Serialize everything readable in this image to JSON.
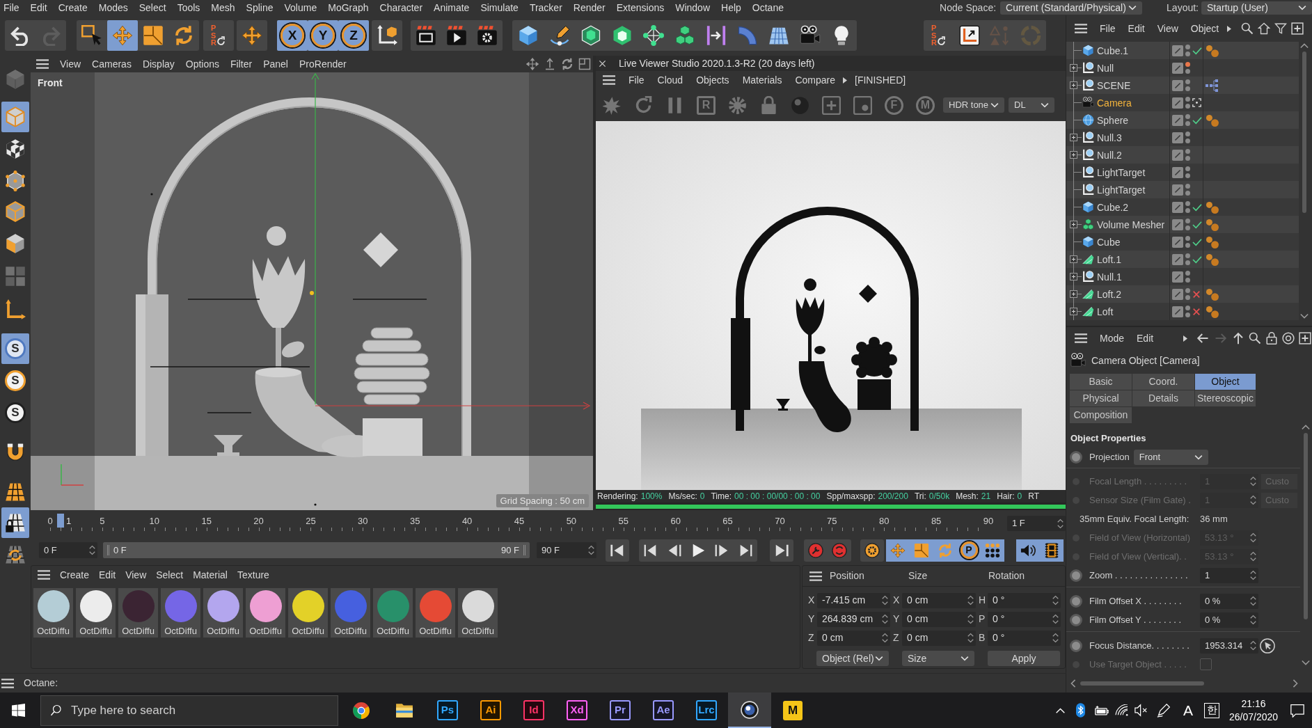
{
  "menu_bar": {
    "items": [
      "File",
      "Edit",
      "Create",
      "Modes",
      "Select",
      "Tools",
      "Mesh",
      "Spline",
      "Volume",
      "MoGraph",
      "Character",
      "Animate",
      "Simulate",
      "Tracker",
      "Render",
      "Extensions",
      "Window",
      "Help",
      "Octane"
    ],
    "node_space": {
      "label": "Node Space:",
      "value": "Current (Standard/Physical)"
    },
    "layout": {
      "label": "Layout:",
      "value": "Startup (User)"
    }
  },
  "main_toolbar": [
    {
      "buttons": [
        {
          "active": false,
          "disabled": false
        },
        {
          "active": false,
          "disabled": true
        }
      ]
    },
    {
      "buttons": [
        {
          "active": false,
          "disabled": false
        },
        {
          "active": true,
          "disabled": false
        },
        {
          "active": false,
          "disabled": false
        },
        {
          "active": false,
          "disabled": false
        }
      ]
    },
    {
      "buttons": [
        {
          "label": "PSR",
          "active": false,
          "disabled": false
        }
      ]
    },
    {
      "buttons": [
        {
          "active": false,
          "disabled": false
        }
      ]
    },
    {
      "buttons": [
        {
          "label": "X",
          "active": true,
          "disabled": false
        },
        {
          "label": "Y",
          "active": true,
          "disabled": false
        },
        {
          "label": "Z",
          "active": true,
          "disabled": false
        }
      ]
    },
    {
      "buttons": [
        {
          "active": false,
          "disabled": false
        }
      ]
    },
    {
      "buttons": [
        {
          "active": false,
          "disabled": false
        },
        {
          "active": false,
          "disabled": false
        },
        {
          "active": false,
          "disabled": false
        }
      ]
    },
    {
      "buttons": [
        {
          "active": false,
          "disabled": false
        },
        {
          "active": false,
          "disabled": false
        },
        {
          "active": false,
          "disabled": false
        },
        {
          "active": false,
          "disabled": false
        },
        {
          "active": false,
          "disabled": false
        },
        {
          "active": false,
          "disabled": false
        },
        {
          "active": false,
          "disabled": false
        },
        {
          "active": false,
          "disabled": false
        },
        {
          "active": false,
          "disabled": false
        },
        {
          "active": false,
          "disabled": false
        },
        {
          "active": false,
          "disabled": false
        }
      ]
    },
    {
      "buttons": [
        {
          "label": "PSR",
          "active": false,
          "disabled": false
        },
        {
          "active": false,
          "disabled": false
        },
        {
          "active": false,
          "disabled": true
        },
        {
          "active": false,
          "disabled": true
        }
      ]
    }
  ],
  "left_toolbar": [
    {
      "active": false,
      "disabled": true
    },
    {
      "active": true,
      "disabled": false
    },
    {
      "active": false,
      "disabled": false
    },
    {
      "active": false,
      "disabled": false
    },
    {
      "active": false,
      "disabled": false
    },
    {
      "active": false,
      "disabled": false
    },
    {
      "active": false,
      "disabled": true
    },
    {
      "active": false,
      "disabled": false
    },
    {
      "label": "S",
      "active": true,
      "disabled": false
    },
    {
      "label": "S",
      "active": false,
      "disabled": false
    },
    {
      "label": "S",
      "active": false,
      "disabled": false
    },
    {
      "active": false,
      "disabled": false
    },
    {
      "active": false,
      "disabled": false
    },
    {
      "active": true,
      "disabled": false
    },
    {
      "active": false,
      "disabled": false
    }
  ],
  "viewport": {
    "menu": [
      "View",
      "Cameras",
      "Display",
      "Options",
      "Filter",
      "Panel",
      "ProRender"
    ],
    "view_label": "Front",
    "grid_spacing": "Grid Spacing : 50 cm"
  },
  "live_viewer": {
    "title": "Live Viewer Studio 2020.1.3-R2 (20 days left)",
    "menu": [
      "File",
      "Cloud",
      "Objects",
      "Materials",
      "Compare"
    ],
    "state": "[FINISHED]",
    "toolbar": [
      {
        "disabled": true
      },
      {
        "disabled": true
      },
      {
        "disabled": true
      },
      {
        "label": "R",
        "disabled": true
      },
      {
        "disabled": true
      },
      {
        "disabled": true
      },
      {
        "disabled": true
      },
      {
        "disabled": true
      },
      {
        "disabled": true
      },
      {
        "label": "F",
        "disabled": true
      },
      {
        "label": "M",
        "disabled": true
      }
    ],
    "tone_mapping": "HDR tone",
    "channel": "DL",
    "stats": [
      {
        "label": "Rendering:",
        "value": "100%"
      },
      {
        "label": "Ms/sec:",
        "value": "0"
      },
      {
        "label": "Time:",
        "value": "00 : 00 : 00/00 : 00 : 00"
      },
      {
        "label": "Spp/maxspp:",
        "value": "200/200"
      },
      {
        "label": "Tri:",
        "value": "0/50k"
      },
      {
        "label": "Mesh:",
        "value": "21"
      },
      {
        "label": "Hair:",
        "value": "0"
      },
      {
        "label": "RT"
      }
    ],
    "progress": {
      "level": 1
    }
  },
  "timeline": {
    "ruler_labels": [
      "0",
      "5",
      "10",
      "15",
      "20",
      "25",
      "30",
      "35",
      "40",
      "45",
      "50",
      "55",
      "60",
      "65",
      "70",
      "75",
      "80",
      "85",
      "90"
    ],
    "playhead": {
      "label": "1",
      "level": 0.0111
    },
    "current_frame": "1 F",
    "start_frame": "0 F",
    "range_start": "0 F",
    "range_end": "90 F",
    "end_frame": "90 F",
    "buttons": [
      {
        "active": false
      },
      {
        "active": false
      },
      {
        "active": false
      },
      {
        "active": false
      },
      {
        "active": false
      },
      {
        "active": false
      },
      {
        "active": false
      },
      {
        "active": false
      },
      {
        "active": false
      },
      {
        "active": false
      },
      {
        "active": true
      },
      {
        "active": true
      },
      {
        "active": true
      },
      {
        "label": "P",
        "active": true
      },
      {
        "active": true
      },
      {
        "active": true
      },
      {
        "active": true
      }
    ]
  },
  "material_manager": {
    "menu": [
      "Create",
      "Edit",
      "View",
      "Select",
      "Material",
      "Texture"
    ],
    "materials": [
      {
        "name": "OctDiffu",
        "color": "#b4cdd6"
      },
      {
        "name": "OctDiffu",
        "color": "#ececec"
      },
      {
        "name": "OctDiffu",
        "color": "#3b2433"
      },
      {
        "name": "OctDiffu",
        "color": "#7566e6"
      },
      {
        "name": "OctDiffu",
        "color": "#b3a6ee"
      },
      {
        "name": "OctDiffu",
        "color": "#ee9fd3"
      },
      {
        "name": "OctDiffu",
        "color": "#e3d128"
      },
      {
        "name": "OctDiffu",
        "color": "#4660df"
      },
      {
        "name": "OctDiffu",
        "color": "#28906a"
      },
      {
        "name": "OctDiffu",
        "color": "#e54a35"
      },
      {
        "name": "OctDiffu",
        "color": "#dadada"
      }
    ]
  },
  "coordinates": {
    "headers": [
      "Position",
      "Size",
      "Rotation"
    ],
    "rows": [
      [
        {
          "axis": "X",
          "value": "-7.415 cm"
        },
        {
          "axis": "X",
          "value": "0 cm"
        },
        {
          "axis": "H",
          "value": "0 °"
        }
      ],
      [
        {
          "axis": "Y",
          "value": "264.839 cm"
        },
        {
          "axis": "Y",
          "value": "0 cm"
        },
        {
          "axis": "P",
          "value": "0 °"
        }
      ],
      [
        {
          "axis": "Z",
          "value": "0 cm"
        },
        {
          "axis": "Z",
          "value": "0 cm"
        },
        {
          "axis": "B",
          "value": "0 °"
        }
      ]
    ],
    "mode": "Object (Rel)",
    "size_mode": "Size",
    "apply": "Apply"
  },
  "status_bar": {
    "text": "Octane:"
  },
  "object_manager": {
    "menu": [
      "File",
      "Edit",
      "View",
      "Object"
    ],
    "objects": [
      {
        "name": "Cube.1",
        "kind": "cube",
        "expandable": false,
        "selected": false,
        "editor_hidden": false,
        "status": {
          "kind": "check"
        },
        "tag": {
          "kind": "material"
        }
      },
      {
        "name": "Null",
        "kind": "null",
        "expandable": true,
        "selected": false,
        "editor_hidden": true
      },
      {
        "name": "SCENE",
        "kind": "null",
        "expandable": true,
        "selected": false,
        "editor_hidden": false,
        "tag": {
          "kind": "hierarchy"
        }
      },
      {
        "name": "Camera",
        "kind": "camera",
        "expandable": false,
        "selected": true,
        "editor_hidden": false,
        "status": {
          "kind": "camera_focus"
        }
      },
      {
        "name": "Sphere",
        "kind": "sphere",
        "expandable": false,
        "selected": false,
        "editor_hidden": false,
        "status": {
          "kind": "check"
        },
        "tag": {
          "kind": "material"
        }
      },
      {
        "name": "Null.3",
        "kind": "null",
        "expandable": true,
        "selected": false,
        "editor_hidden": false
      },
      {
        "name": "Null.2",
        "kind": "null",
        "expandable": true,
        "selected": false,
        "editor_hidden": false
      },
      {
        "name": "LightTarget",
        "kind": "null",
        "expandable": false,
        "selected": false,
        "editor_hidden": false
      },
      {
        "name": "LightTarget",
        "kind": "null",
        "expandable": false,
        "selected": false,
        "editor_hidden": false
      },
      {
        "name": "Cube.2",
        "kind": "cube",
        "expandable": false,
        "selected": false,
        "editor_hidden": false,
        "status": {
          "kind": "check"
        },
        "tag": {
          "kind": "material"
        }
      },
      {
        "name": "Volume Mesher",
        "kind": "volume_mesher",
        "expandable": true,
        "selected": false,
        "editor_hidden": false,
        "status": {
          "kind": "check"
        },
        "tag": {
          "kind": "material"
        }
      },
      {
        "name": "Cube",
        "kind": "cube",
        "expandable": false,
        "selected": false,
        "editor_hidden": false,
        "status": {
          "kind": "check"
        },
        "tag": {
          "kind": "material"
        }
      },
      {
        "name": "Loft.1",
        "kind": "loft",
        "expandable": true,
        "selected": false,
        "editor_hidden": false,
        "status": {
          "kind": "check"
        },
        "tag": {
          "kind": "material"
        }
      },
      {
        "name": "Null.1",
        "kind": "null",
        "expandable": true,
        "selected": false,
        "editor_hidden": false
      },
      {
        "name": "Loft.2",
        "kind": "loft",
        "expandable": true,
        "selected": false,
        "editor_hidden": false,
        "status": {
          "kind": "cross"
        },
        "tag": {
          "kind": "material"
        }
      },
      {
        "name": "Loft",
        "kind": "loft",
        "expandable": true,
        "selected": false,
        "editor_hidden": false,
        "status": {
          "kind": "cross"
        },
        "tag": {
          "kind": "material"
        }
      }
    ]
  },
  "attributes": {
    "menu": [
      "Mode",
      "Edit"
    ],
    "title": "Camera Object [Camera]",
    "tabs": [
      {
        "label": "Basic",
        "selected": false
      },
      {
        "label": "Coord.",
        "selected": false
      },
      {
        "label": "Object",
        "selected": true
      },
      {
        "label": "Physical",
        "selected": false
      },
      {
        "label": "Details",
        "selected": false
      },
      {
        "label": "Stereoscopic",
        "selected": false
      },
      {
        "label": "Composition",
        "selected": false
      }
    ],
    "section": "Object Properties",
    "groups": [
      [
        {
          "kind": "dropdown",
          "label": "Projection",
          "value": "Front",
          "disabled": false
        }
      ],
      [
        {
          "kind": "number",
          "label": "Focal Length . . . . . . . . .",
          "value": "1",
          "button": "Custo",
          "disabled": true
        },
        {
          "kind": "number",
          "label": "Sensor Size (Film Gate) .",
          "value": "1",
          "button": "Custo",
          "disabled": true
        },
        {
          "kind": "info",
          "label": "35mm Equiv. Focal Length:",
          "value": "36 mm",
          "disabled": false
        },
        {
          "kind": "number",
          "label": "Field of View (Horizontal)",
          "value": "53.13 °",
          "disabled": true
        },
        {
          "kind": "number",
          "label": "Field of View (Vertical). .",
          "value": "53.13 °",
          "disabled": true
        },
        {
          "kind": "number",
          "label": "Zoom . . . . . . . . . . . . . . .",
          "value": "1",
          "disabled": false
        }
      ],
      [
        {
          "kind": "number",
          "label": "Film Offset X . . . . . . . .",
          "value": "0 %",
          "disabled": false
        },
        {
          "kind": "number",
          "label": "Film Offset Y . . . . . . . .",
          "value": "0 %",
          "disabled": false
        }
      ],
      [
        {
          "kind": "pick",
          "label": "Focus Distance. . . . . . . .",
          "value": "1953.314",
          "disabled": false
        },
        {
          "kind": "checkbox",
          "label": "Use Target Object . . . . .",
          "checked": false,
          "disabled": true
        }
      ]
    ]
  },
  "taskbar": {
    "search_placeholder": "Type here to search",
    "apps": [
      {
        "kind": "browser",
        "selected": false
      },
      {
        "kind": "folder",
        "selected": false
      },
      {
        "kind": "letters",
        "label": "Ps",
        "color": "#31a8ff",
        "selected": false
      },
      {
        "kind": "letters",
        "label": "Ai",
        "color": "#ff9a00",
        "selected": false
      },
      {
        "kind": "letters",
        "label": "Id",
        "color": "#ff3366",
        "selected": false
      },
      {
        "kind": "letters",
        "label": "Xd",
        "color": "#ff61f6",
        "selected": false
      },
      {
        "kind": "letters",
        "label": "Pr",
        "color": "#9999ff",
        "selected": false
      },
      {
        "kind": "letters",
        "label": "Ae",
        "color": "#9999ff",
        "selected": false
      },
      {
        "kind": "letters",
        "label": "Lrc",
        "color": "#31a8ff",
        "selected": false
      },
      {
        "kind": "sphere_logo",
        "selected": true
      },
      {
        "kind": "badge",
        "label": "M",
        "color": "#f5c518",
        "selected": false
      }
    ],
    "input_mode": "A",
    "ime": "한",
    "time": "21:16",
    "date": "26/07/2020"
  }
}
